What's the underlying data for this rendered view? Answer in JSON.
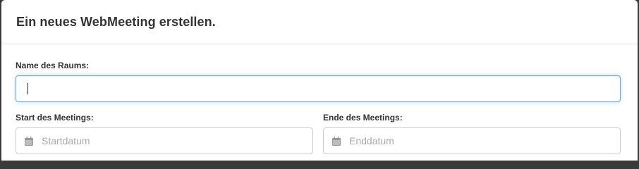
{
  "dialog": {
    "title": "Ein neues WebMeeting erstellen."
  },
  "form": {
    "room_name": {
      "label": "Name des Raums:",
      "value": ""
    },
    "start": {
      "label": "Start des Meetings:",
      "placeholder": "Startdatum",
      "icon": "calendar-icon"
    },
    "end": {
      "label": "Ende des Meetings:",
      "placeholder": "Enddatum",
      "icon": "calendar-icon"
    }
  },
  "colors": {
    "focus_border": "#66afe9",
    "input_border": "#cccccc",
    "placeholder": "#a9a9a9",
    "icon": "#999999"
  }
}
